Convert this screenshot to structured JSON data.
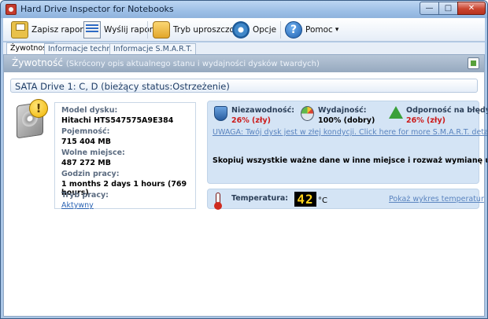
{
  "window": {
    "title": "Hard Drive Inspector for Notebooks",
    "controls": {
      "minimize": "—",
      "maximize": "□",
      "close": "✕"
    }
  },
  "toolbar": {
    "save_report": "Zapisz raport",
    "send_report": "Wyślij raport",
    "simple_mode": "Tryb uproszczony",
    "options": "Opcje",
    "help": "Pomoc",
    "help_glyph": "?",
    "dropdown_glyph": "▾"
  },
  "tabs": [
    {
      "label": "Żywotność",
      "active": true
    },
    {
      "label": "Informacje techniczne",
      "active": false
    },
    {
      "label": "Informacje S.M.A.R.T.",
      "active": false
    }
  ],
  "header": {
    "title": "Żywotność",
    "subtitle": "(Skrócony opis aktualnego stanu i wydajności dysków twardych)"
  },
  "drive": {
    "title": "SATA Drive 1: C, D (bieżący status:Ostrzeżenie)",
    "warn_glyph": "!",
    "info": {
      "model_label": "Model dysku:",
      "model_value": "Hitachi HTS547575A9E384",
      "capacity_label": "Pojemność:",
      "capacity_value": "715 404 MB",
      "free_label": "Wolne miejsce:",
      "free_value": "487 272 MB",
      "hours_label": "Godzin pracy:",
      "hours_value": "1 months 2 days 1 hours (769 hours)",
      "mode_label": "Tryb pracy:",
      "mode_value": "Aktywny"
    }
  },
  "status": {
    "reliability": {
      "label": "Niezawodność:",
      "value": "26% (zły)",
      "color": "#cc1a1a"
    },
    "performance": {
      "label": "Wydajność:",
      "value": "100% (dobry)",
      "color": "#000000"
    },
    "fault_tolerance": {
      "label": "Odporność na błędy:",
      "value": "26% (zły)",
      "color": "#cc1a1a"
    },
    "warning_link": "UWAGA: Twój dysk jest w złej kondycji. Click here for more S.M.A.R.T. details...",
    "advice": "Skopiuj wszystkie ważne dane w inne miejsce i rozważ wymianę urządzenia."
  },
  "temperature": {
    "label": "Temperatura:",
    "value": "42",
    "unit": "°C",
    "chart_link": "Pokaż wykres temperatur"
  }
}
